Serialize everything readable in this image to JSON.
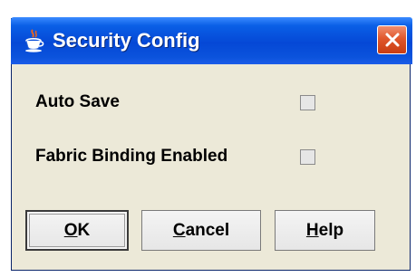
{
  "window": {
    "title": "Security Config",
    "icon": "java-coffee-cup-icon",
    "close_icon": "close-icon",
    "close_color": "#d9502a",
    "titlebar_color": "#0548d6",
    "body_color": "#ece9d8"
  },
  "settings": [
    {
      "label": "Auto Save",
      "checked": false
    },
    {
      "label": "Fabric Binding Enabled",
      "checked": false
    }
  ],
  "buttons": {
    "ok": {
      "mnemonic": "O",
      "rest": "K"
    },
    "cancel": {
      "mnemonic": "C",
      "rest": "ancel"
    },
    "help": {
      "mnemonic": "H",
      "rest": "elp"
    }
  }
}
